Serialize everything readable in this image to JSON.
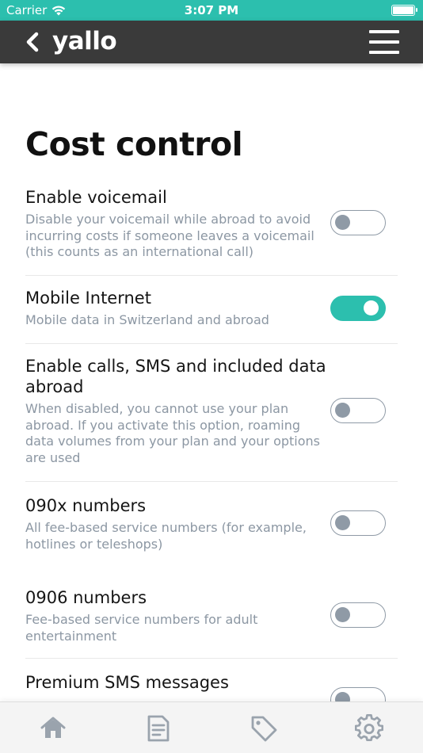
{
  "status_bar": {
    "carrier": "Carrier",
    "time": "3:07 PM",
    "wifi_icon": "wifi-icon",
    "battery_icon": "battery-icon"
  },
  "nav": {
    "brand": "yallo",
    "back_icon": "chevron-left-icon",
    "menu_icon": "hamburger-menu-icon"
  },
  "page": {
    "title": "Cost control"
  },
  "settings": [
    {
      "title": "Enable voicemail",
      "description": "Disable your voicemail while abroad to avoid incurring costs if someone leaves a voicemail (this counts as an international call)",
      "enabled": false
    },
    {
      "title": "Mobile Internet",
      "description": "Mobile data in Switzerland and abroad",
      "enabled": true
    },
    {
      "title": "Enable calls, SMS and included data abroad",
      "description": "When disabled, you cannot use your plan abroad. If you activate this option, roaming data volumes from your plan and your options are used",
      "enabled": false
    },
    {
      "title": "090x numbers",
      "description": "All fee-based service numbers (for example, hotlines or teleshops)",
      "enabled": false
    },
    {
      "title": "0906 numbers",
      "description": "Fee-based service numbers for adult entertainment",
      "enabled": false
    },
    {
      "title": "Premium SMS messages",
      "description": "",
      "enabled": false
    }
  ],
  "tabs": [
    {
      "icon": "home-icon"
    },
    {
      "icon": "document-icon"
    },
    {
      "icon": "tag-icon"
    },
    {
      "icon": "gear-icon"
    }
  ],
  "colors": {
    "accent": "#2cbfae",
    "nav_background": "#3a3a3a",
    "toggle_off": "#8f9aa6",
    "description_text": "#8c97a3",
    "tab_icon": "#9aa3ad"
  }
}
